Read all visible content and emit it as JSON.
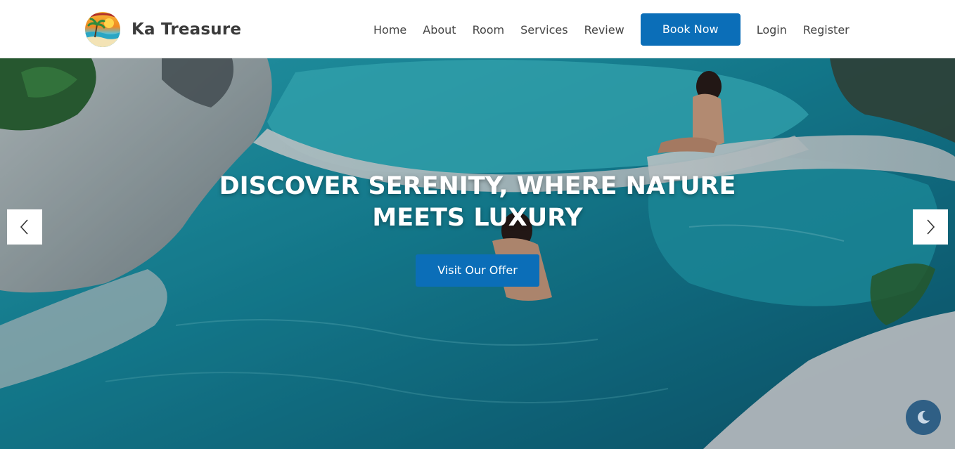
{
  "brand": {
    "name": "Ka Treasure",
    "logo_icon": "resort-logo-icon"
  },
  "nav": {
    "links": [
      {
        "label": "Home"
      },
      {
        "label": "About"
      },
      {
        "label": "Room"
      },
      {
        "label": "Services"
      },
      {
        "label": "Review"
      }
    ],
    "book_label": "Book Now",
    "login_label": "Login",
    "register_label": "Register"
  },
  "hero": {
    "title": "Discover serenity, where nature meets luxury",
    "offer_label": "Visit Our Offer",
    "prev_icon": "chevron-left-icon",
    "next_icon": "chevron-right-icon",
    "background": "natural-pool-photo"
  },
  "theme_toggle": {
    "icon": "moon-icon"
  },
  "colors": {
    "primary": "#0b6eb8",
    "nav_text": "#444444",
    "brand_text": "#3a3a3a",
    "toggle_bg": "#2f5f85",
    "water": "#1aa3b8"
  }
}
